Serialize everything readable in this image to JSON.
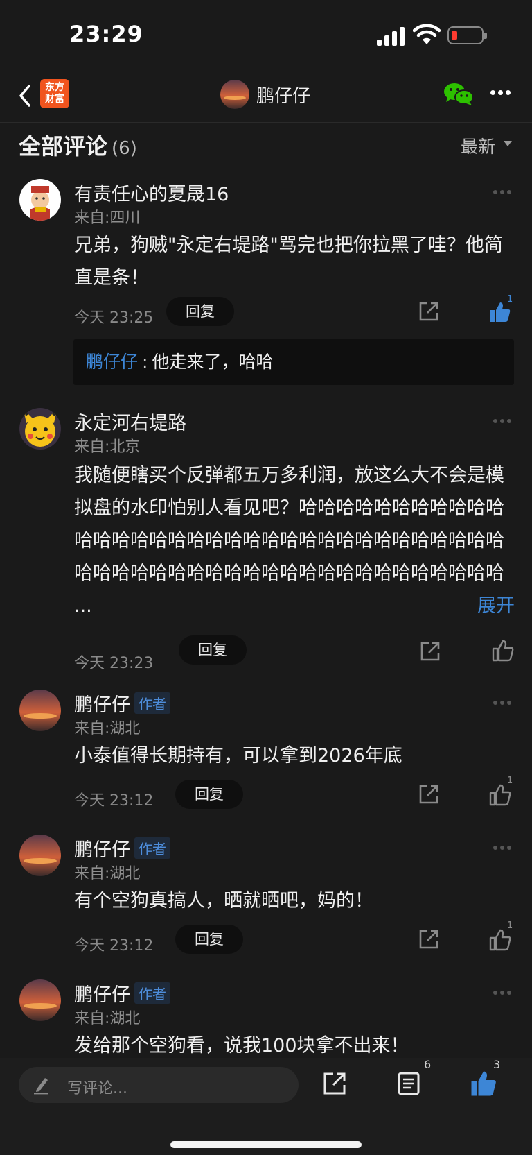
{
  "status_bar": {
    "time": "23:29"
  },
  "nav": {
    "brand_label_line1": "东方",
    "brand_label_line2": "财富",
    "title": "鹏仔仔"
  },
  "section": {
    "title": "全部评论",
    "count": "(6)",
    "sort_label": "最新"
  },
  "comments": [
    {
      "username": "有责任心的夏晟16",
      "location": "来自:四川",
      "text": "兄弟，狗贼\"永定右堤路\"骂完也把你拉黑了哇？他简直是条！",
      "time": "今天 23:25",
      "reply_label": "回复",
      "like_count": "1",
      "liked": true,
      "sub_reply": {
        "name": "鹏仔仔",
        "colon": ":",
        "text": "他走来了，哈哈"
      }
    },
    {
      "username": "永定河右堤路",
      "location": "来自:北京",
      "text": "我随便瞎买个反弹都五万多利润，放这么大不会是模拟盘的水印怕别人看见吧？哈哈哈哈哈哈哈哈哈哈哈哈哈哈哈哈哈哈哈哈哈哈哈哈哈哈哈哈哈哈哈哈哈哈哈哈哈哈哈哈哈哈哈哈哈哈哈哈哈哈哈哈哈哈哈哈哈 ...",
      "expand_label": "展开",
      "time": "今天 23:23",
      "reply_label": "回复",
      "liked": false
    },
    {
      "username": "鹏仔仔",
      "badge": "作者",
      "location": "来自:湖北",
      "text": "小泰值得长期持有，可以拿到2026年底",
      "time": "今天 23:12",
      "reply_label": "回复",
      "like_count": "1",
      "liked": false
    },
    {
      "username": "鹏仔仔",
      "badge": "作者",
      "location": "来自:湖北",
      "text": "有个空狗真搞人，晒就晒吧，妈的！",
      "time": "今天 23:12",
      "reply_label": "回复",
      "like_count": "1",
      "liked": false
    },
    {
      "username": "鹏仔仔",
      "badge": "作者",
      "location": "来自:湖北",
      "text": "发给那个空狗看，说我100块拿不出来！"
    }
  ],
  "bottom_bar": {
    "placeholder": "写评论...",
    "comment_count": "6",
    "like_count": "3"
  },
  "colors": {
    "accent_blue": "#3d86d6",
    "brand_orange": "#f0541e",
    "wechat_green": "#2dc100",
    "background": "#1a1a1a"
  }
}
